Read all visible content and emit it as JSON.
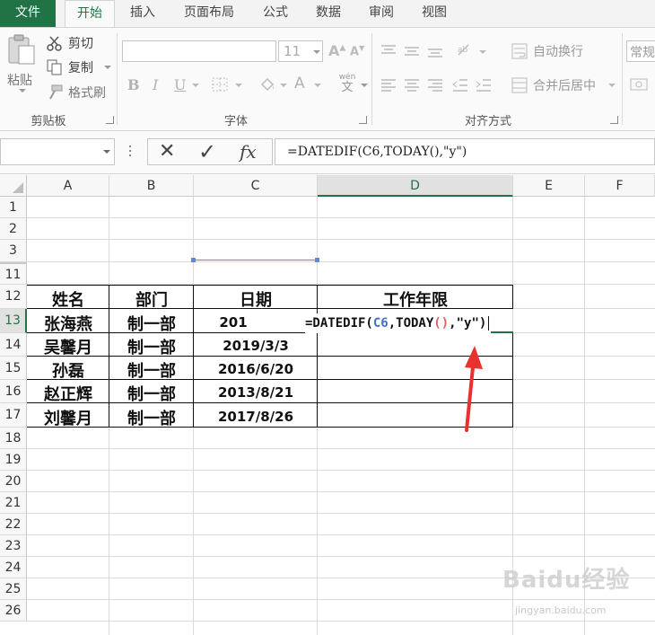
{
  "tabs": [
    {
      "label": "文件",
      "kind": "file"
    },
    {
      "label": "开始",
      "kind": "active"
    },
    {
      "label": "插入",
      "kind": ""
    },
    {
      "label": "页面布局",
      "kind": ""
    },
    {
      "label": "公式",
      "kind": ""
    },
    {
      "label": "数据",
      "kind": ""
    },
    {
      "label": "审阅",
      "kind": ""
    },
    {
      "label": "视图",
      "kind": ""
    }
  ],
  "ribbon": {
    "clipboard": {
      "paste": "粘贴",
      "cut": "剪切",
      "copy": "复制",
      "format_painter": "格式刷",
      "group_label": "剪贴板"
    },
    "font": {
      "font_size": "11",
      "bold": "B",
      "italic": "I",
      "underline": "U",
      "font_color_letter": "A",
      "phonetic": "wén",
      "phonetic_char": "文",
      "group_label": "字体"
    },
    "alignment": {
      "wrap_text": "自动换行",
      "merge_center": "合并后居中",
      "group_label": "对齐方式"
    },
    "number": {
      "format": "常规"
    }
  },
  "formula_bar": {
    "cancel": "✕",
    "confirm": "✓",
    "fx": "fx",
    "formula": "=DATEDIF(C6,TODAY(),\"y\")"
  },
  "columns": [
    {
      "label": "A",
      "selected": false
    },
    {
      "label": "B",
      "selected": false
    },
    {
      "label": "C",
      "selected": false
    },
    {
      "label": "D",
      "selected": true
    },
    {
      "label": "E",
      "selected": false
    },
    {
      "label": "F",
      "selected": false
    }
  ],
  "rows": [
    {
      "label": "1",
      "selected": false
    },
    {
      "label": "2",
      "selected": false
    },
    {
      "label": "3",
      "selected": false
    },
    {
      "label": "11",
      "selected": false
    },
    {
      "label": "12",
      "selected": false
    },
    {
      "label": "13",
      "selected": true
    },
    {
      "label": "14",
      "selected": false
    },
    {
      "label": "15",
      "selected": false
    },
    {
      "label": "16",
      "selected": false
    },
    {
      "label": "17",
      "selected": false
    },
    {
      "label": "18",
      "selected": false
    },
    {
      "label": "19",
      "selected": false
    },
    {
      "label": "20",
      "selected": false
    },
    {
      "label": "21",
      "selected": false
    },
    {
      "label": "22",
      "selected": false
    },
    {
      "label": "23",
      "selected": false
    },
    {
      "label": "24",
      "selected": false
    },
    {
      "label": "25",
      "selected": false
    },
    {
      "label": "26",
      "selected": false
    }
  ],
  "table": {
    "headers": [
      "姓名",
      "部门",
      "日期",
      "工作年限"
    ],
    "rows": [
      {
        "name": "张海燕",
        "dept": "制一部",
        "date": "201"
      },
      {
        "name": "吴馨月",
        "dept": "制一部",
        "date": "2019/3/3"
      },
      {
        "name": "孙磊",
        "dept": "制一部",
        "date": "2016/6/20"
      },
      {
        "name": "赵正辉",
        "dept": "制一部",
        "date": "2013/8/21"
      },
      {
        "name": "刘馨月",
        "dept": "制一部",
        "date": "2017/8/26"
      }
    ]
  },
  "editing": {
    "prefix": "=DATEDIF(",
    "ref": "C6",
    "sep1": ",TODAY",
    "parens": "()",
    "tail": ",\"y\")"
  },
  "watermark": {
    "brand": "Baidu经验",
    "url": "jingyan.baidu.com"
  },
  "colors": {
    "excel_green": "#217346",
    "ref_blue": "#4472c4",
    "paren_red": "#e06060",
    "arrow_red": "#e8322f"
  }
}
